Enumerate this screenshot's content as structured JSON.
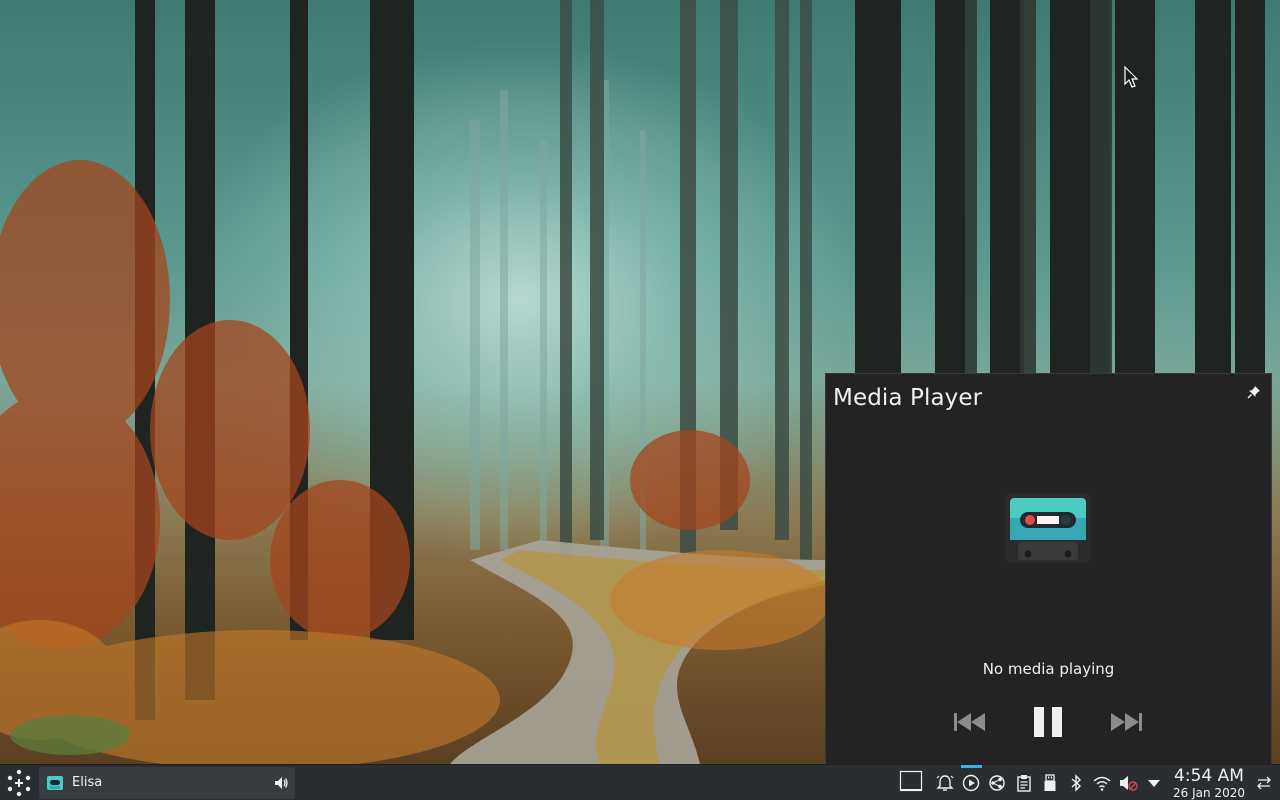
{
  "media_player": {
    "title": "Media Player",
    "status": "No media playing",
    "icons": {
      "pin": "pin-icon",
      "album_art": "cassette-icon",
      "previous": "skip-backward-icon",
      "pause": "pause-icon",
      "next": "skip-forward-icon"
    }
  },
  "taskbar": {
    "launcher_icon": "application-launcher-icon",
    "tasks": [
      {
        "label": "Elisa",
        "icon": "elisa-app-icon",
        "audio_icon": "speaker-icon"
      }
    ],
    "tray_icons": [
      "show-desktop-icon",
      "notifications-icon",
      "media-player-icon",
      "kde-connect-icon",
      "clipboard-icon",
      "usb-drive-icon",
      "bluetooth-icon",
      "wifi-icon",
      "volume-muted-icon",
      "expand-tray-icon"
    ],
    "clock": {
      "time": "4:54 AM",
      "date": "26 Jan 2020"
    },
    "config_icon": "panel-settings-icon"
  },
  "colors": {
    "popup_bg": "#232323",
    "panel_bg": "#2a2e32",
    "text": "#eff0f1",
    "accent": "#3daee9"
  }
}
